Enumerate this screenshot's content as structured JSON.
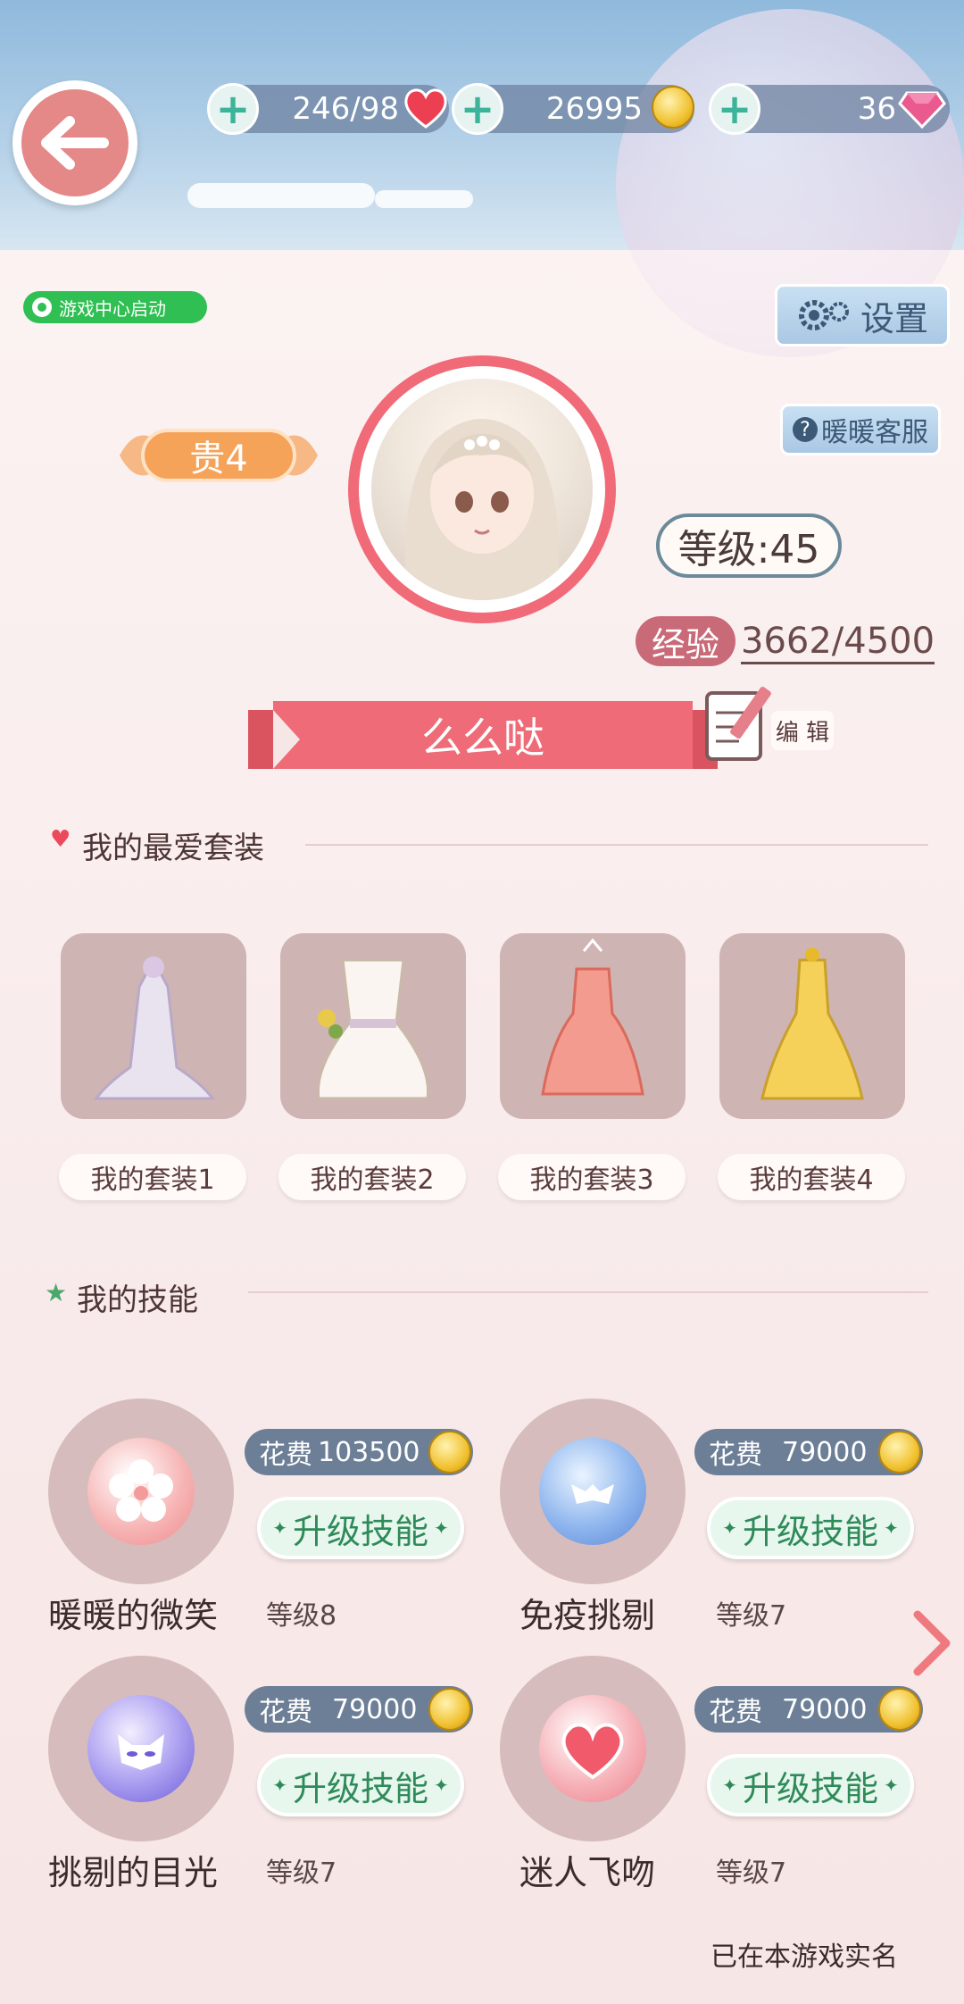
{
  "header": {
    "hearts": "246/98",
    "coins": "26995",
    "gems": "36"
  },
  "badges": {
    "game_center": "游戏中心启动",
    "settings": "设置",
    "support": "暖暖客服",
    "vip": "贵4"
  },
  "profile": {
    "level": "等级:45",
    "exp_label": "经验",
    "exp_value": "3662/4500",
    "name": "么么哒",
    "edit": "编 辑"
  },
  "favorites": {
    "title": "我的最爱套装",
    "items": [
      {
        "label": "我的套装1"
      },
      {
        "label": "我的套装2"
      },
      {
        "label": "我的套装3"
      },
      {
        "label": "我的套装4"
      }
    ]
  },
  "skills": {
    "title": "我的技能",
    "upgrade_label": "升级技能",
    "items": [
      {
        "name": "暖暖的微笑",
        "level": "等级8",
        "cost_label": "花费",
        "cost": "103500"
      },
      {
        "name": "免疫挑剔",
        "level": "等级7",
        "cost_label": "花费",
        "cost": "79000"
      },
      {
        "name": "挑剔的目光",
        "level": "等级7",
        "cost_label": "花费",
        "cost": "79000"
      },
      {
        "name": "迷人飞吻",
        "level": "等级7",
        "cost_label": "花费",
        "cost": "79000"
      }
    ]
  },
  "footer": {
    "real_name": "已在本游戏实名"
  },
  "colors": {
    "accent_pink": "#ee6b77",
    "vip_orange": "#f6a35a",
    "upgrade_green": "#2f8a5a",
    "cost_bg": "#6d7f97"
  }
}
